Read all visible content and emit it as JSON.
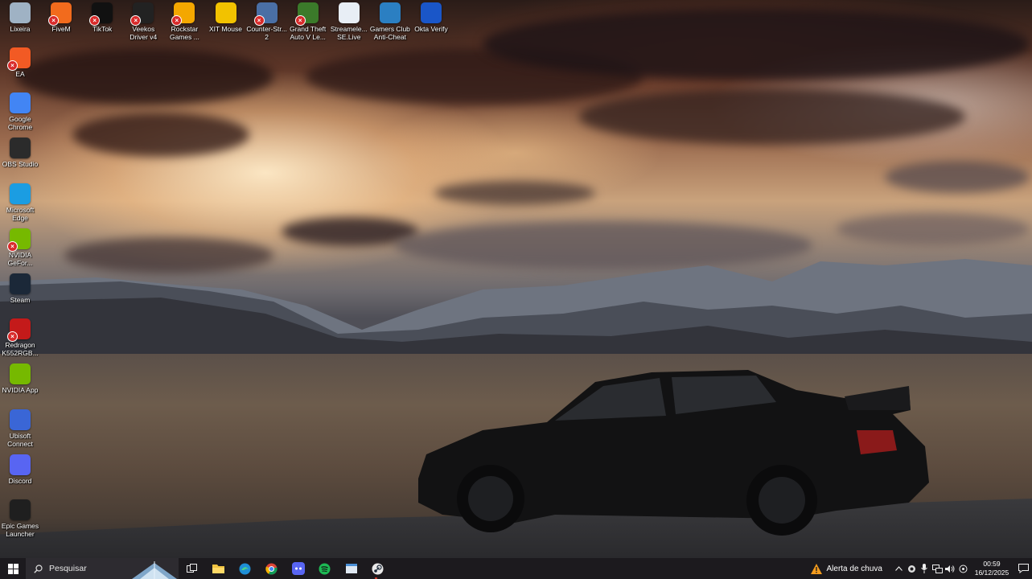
{
  "desktop": {
    "top_row": [
      {
        "label": "Lixeira",
        "icon": "recycle-bin-icon",
        "color": "#9fb2c4",
        "shortcut": false
      },
      {
        "label": "FiveM",
        "icon": "fivem-icon",
        "color": "#f26b1d",
        "shortcut": true
      },
      {
        "label": "TikTok",
        "icon": "tiktok-icon",
        "color": "#111111",
        "shortcut": true
      },
      {
        "label": "Veekos Driver v4",
        "icon": "veekos-driver-icon",
        "color": "#222222",
        "shortcut": true
      },
      {
        "label": "Rockstar Games ...",
        "icon": "rockstar-icon",
        "color": "#f4a700",
        "shortcut": true
      },
      {
        "label": "XIT Mouse",
        "icon": "xit-mouse-icon",
        "color": "#f2c200",
        "shortcut": false
      },
      {
        "label": "Counter-Str... 2",
        "icon": "counter-strike-icon",
        "color": "#4a6fa5",
        "shortcut": true
      },
      {
        "label": "Grand Theft Auto V Le...",
        "icon": "gta-v-icon",
        "color": "#3b7a2a",
        "shortcut": true
      },
      {
        "label": "Streamele... SE.Live",
        "icon": "streamelements-icon",
        "color": "#e8eef5",
        "shortcut": false
      },
      {
        "label": "Gamers Club Anti-Cheat",
        "icon": "gamers-club-icon",
        "color": "#2b7fc2",
        "shortcut": false
      },
      {
        "label": "Okta Verify",
        "icon": "okta-verify-icon",
        "color": "#1a56c8",
        "shortcut": false
      }
    ],
    "left_column": [
      {
        "label": "EA",
        "icon": "ea-icon",
        "color": "#f25a24",
        "shortcut": true
      },
      {
        "label": "Google Chrome",
        "icon": "chrome-icon",
        "color": "#4285f4",
        "shortcut": false
      },
      {
        "label": "OBS Studio",
        "icon": "obs-studio-icon",
        "color": "#2b2b2b",
        "shortcut": false
      },
      {
        "label": "Microsoft Edge",
        "icon": "edge-icon",
        "color": "#1b9de2",
        "shortcut": false
      },
      {
        "label": "NVIDIA GeFor...",
        "icon": "nvidia-geforce-icon",
        "color": "#76b900",
        "shortcut": true
      },
      {
        "label": "Steam",
        "icon": "steam-icon",
        "color": "#1b2838",
        "shortcut": false
      },
      {
        "label": "Redragon K552RGB...",
        "icon": "redragon-icon",
        "color": "#c41a1a",
        "shortcut": true
      },
      {
        "label": "NVIDIA App",
        "icon": "nvidia-app-icon",
        "color": "#76b900",
        "shortcut": false
      },
      {
        "label": "Ubisoft Connect",
        "icon": "ubisoft-connect-icon",
        "color": "#3a66d6",
        "shortcut": false
      },
      {
        "label": "Discord",
        "icon": "discord-icon",
        "color": "#5865f2",
        "shortcut": false
      },
      {
        "label": "Epic Games Launcher",
        "icon": "epic-games-icon",
        "color": "#1f1f1f",
        "shortcut": false
      }
    ]
  },
  "taskbar": {
    "search_placeholder": "Pesquisar",
    "pinned": [
      {
        "name": "task-view-icon"
      },
      {
        "name": "file-explorer-icon"
      },
      {
        "name": "edge-taskbar-icon"
      },
      {
        "name": "chrome-taskbar-icon"
      },
      {
        "name": "discord-taskbar-icon"
      },
      {
        "name": "spotify-taskbar-icon"
      },
      {
        "name": "app-window-taskbar-icon"
      },
      {
        "name": "steam-taskbar-icon"
      }
    ],
    "weather_text": "Alerta de chuva",
    "time": "00:59",
    "date": "16/12/2025"
  }
}
